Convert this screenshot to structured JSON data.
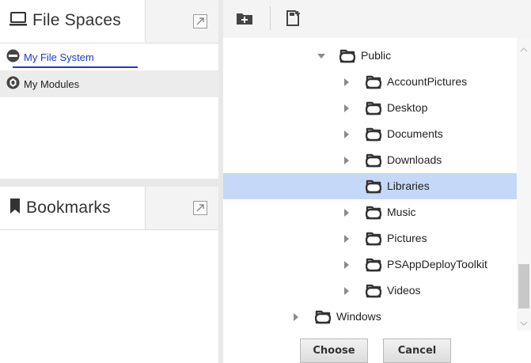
{
  "file_spaces_panel": {
    "title": "File Spaces",
    "icon": "monitor-icon",
    "items": [
      {
        "label": "My File System",
        "icon": "drive-icon",
        "selected": true
      },
      {
        "label": "My Modules",
        "icon": "module-icon",
        "selected": false
      }
    ]
  },
  "bookmarks_panel": {
    "title": "Bookmarks",
    "icon": "bookmark-icon"
  },
  "toolbar": {
    "buttons": [
      {
        "icon": "new-folder-icon"
      },
      {
        "icon": "new-file-icon"
      }
    ]
  },
  "tree": {
    "rows": [
      {
        "label": "Public",
        "expanded": true,
        "selected": false
      },
      {
        "label": "AccountPictures",
        "expanded": false,
        "selected": false
      },
      {
        "label": "Desktop",
        "expanded": false,
        "selected": false
      },
      {
        "label": "Documents",
        "expanded": false,
        "selected": false
      },
      {
        "label": "Downloads",
        "expanded": false,
        "selected": false
      },
      {
        "label": "Libraries",
        "expanded": false,
        "selected": true
      },
      {
        "label": "Music",
        "expanded": false,
        "selected": false
      },
      {
        "label": "Pictures",
        "expanded": false,
        "selected": false
      },
      {
        "label": "PSAppDeployToolkit",
        "expanded": false,
        "selected": false
      },
      {
        "label": "Videos",
        "expanded": false,
        "selected": false
      },
      {
        "label": "Windows",
        "expanded": false,
        "selected": false
      }
    ]
  },
  "buttons": {
    "choose": "Choose",
    "cancel": "Cancel"
  },
  "colors": {
    "selection": "#c6d8f7",
    "link": "#1a3bd1"
  }
}
